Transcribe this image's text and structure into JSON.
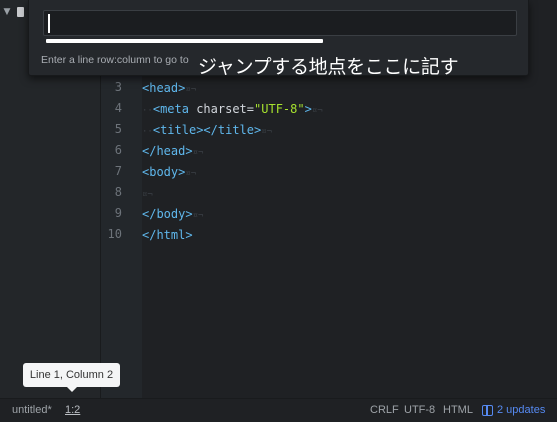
{
  "goto_panel": {
    "input_value": "",
    "hint": "Enter a line row:column to go to",
    "annotation": "ジャンプする地点をここに記す"
  },
  "editor": {
    "lines": [
      {
        "num": "3"
      },
      {
        "num": "4"
      },
      {
        "num": "5"
      },
      {
        "num": "6"
      },
      {
        "num": "7"
      },
      {
        "num": "8"
      },
      {
        "num": "9"
      },
      {
        "num": "10"
      }
    ],
    "code": {
      "line3": "<head>",
      "line4_tag_open": "<meta",
      "line4_attr": "charset",
      "line4_eq": "=",
      "line4_str": "\"UTF-8\"",
      "line4_tag_close": ">",
      "line5": "<title></title>",
      "line6": "</head>",
      "line7": "<body>",
      "line9": "</body>",
      "line10": "</html>",
      "invisible_eol": "¤¬",
      "invisible_indent": "··"
    }
  },
  "tooltip": {
    "text": "Line 1, Column 2"
  },
  "status_bar": {
    "filename": "untitled*",
    "cursor": "1:2",
    "line_ending": "CRLF",
    "encoding": "UTF-8",
    "grammar": "HTML",
    "updates": "2 updates"
  },
  "colors": {
    "accent": "#568af2",
    "tag": "#5fb7ec",
    "string": "#a6e22e",
    "background": "#1f2124"
  },
  "icons": {
    "tree_toggle": "chevron-down-icon",
    "file": "file-icon",
    "updates": "package-icon"
  }
}
